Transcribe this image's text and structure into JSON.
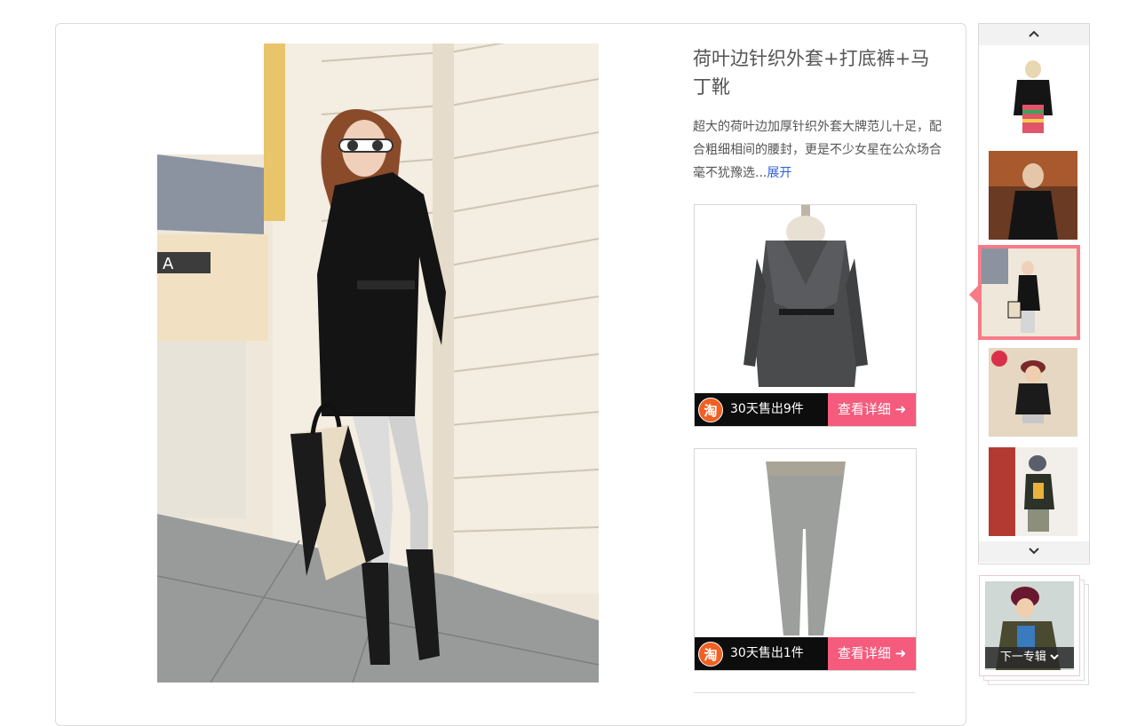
{
  "article": {
    "title": "荷叶边针织外套+打底裤+马丁靴",
    "description": "超大的荷叶边加厚针织外套大牌范儿十足，配合粗细相间的腰封，更是不少女星在公众场合毫不犹豫选",
    "ellipsis": "...",
    "expand_label": "展开"
  },
  "products": [
    {
      "store_icon": "淘",
      "sold_text": "30天售出9件",
      "detail_label": "查看详细 ➜",
      "icon": "coat-product-image"
    },
    {
      "store_icon": "淘",
      "sold_text": "30天售出1件",
      "detail_label": "查看详细 ➜",
      "icon": "leggings-product-image"
    }
  ],
  "sidebar": {
    "up_icon": "chevron-up-icon",
    "down_icon": "chevron-down-icon",
    "active_index": 2,
    "next_topic_label": "下一专辑"
  },
  "colors": {
    "accent_pink": "#f45b7d",
    "active_border": "#f77b87",
    "link_blue": "#2e5fd6",
    "store_orange": "#f16022"
  }
}
